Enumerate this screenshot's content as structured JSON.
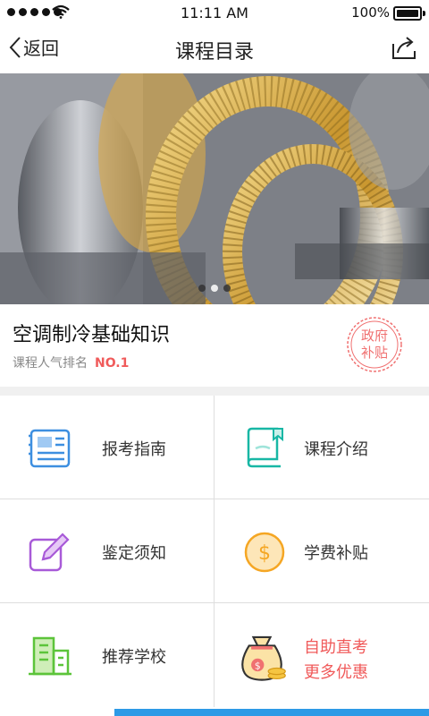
{
  "status_bar": {
    "time": "11:11 AM",
    "battery": "100%"
  },
  "nav": {
    "back_label": "返回",
    "title": "课程目录"
  },
  "banner": {
    "pages": 3,
    "active_page": 1
  },
  "course": {
    "name": "空调制冷基础知识",
    "rank_label": "课程人气排名",
    "rank_value": "NO.1",
    "stamp": "政府\n补贴"
  },
  "menu": [
    {
      "label": "报考指南",
      "icon": "newspaper-icon"
    },
    {
      "label": "课程介绍",
      "icon": "book-bookmark-icon"
    },
    {
      "label": "鉴定须知",
      "icon": "edit-pencil-icon"
    },
    {
      "label": "学费补贴",
      "icon": "dollar-coin-icon"
    },
    {
      "label": "推荐学校",
      "icon": "school-building-icon"
    },
    {
      "label_line1": "自助直考",
      "label_line2": "更多优惠",
      "icon": "money-bag-icon"
    }
  ],
  "colors": {
    "accent_red": "#f05a5a",
    "accent_blue": "#2d9ae6"
  }
}
